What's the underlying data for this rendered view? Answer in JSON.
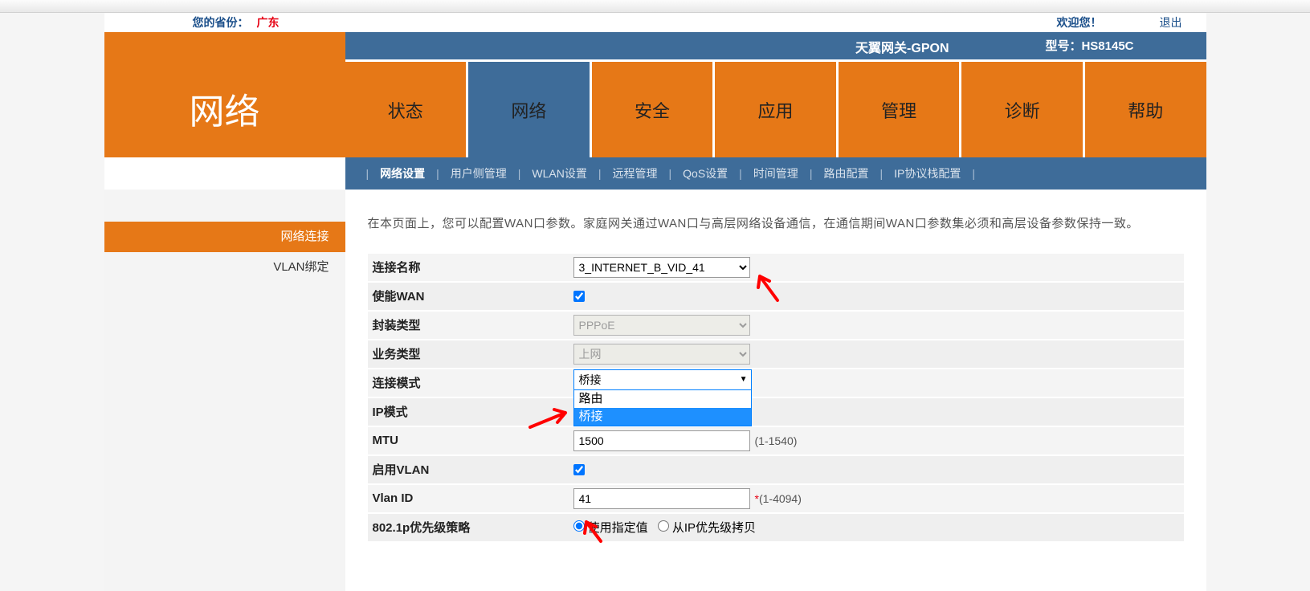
{
  "topbar": {
    "province_label": "您的省份：",
    "province_value": "广东",
    "welcome": "欢迎您！",
    "logout": "退出"
  },
  "header": {
    "gateway": "天翼网关-GPON",
    "model_label": "型号：",
    "model_value": "HS8145C",
    "section_title": "网络"
  },
  "main_tabs": [
    "状态",
    "网络",
    "安全",
    "应用",
    "管理",
    "诊断",
    "帮助"
  ],
  "main_tab_active": 1,
  "sub_tabs": [
    "网络设置",
    "用户侧管理",
    "WLAN设置",
    "远程管理",
    "QoS设置",
    "时间管理",
    "路由配置",
    "IP协议栈配置"
  ],
  "sub_tab_active": 0,
  "side_items": [
    "网络连接",
    "VLAN绑定"
  ],
  "side_active": 0,
  "description": "在本页面上，您可以配置WAN口参数。家庭网关通过WAN口与高层网络设备通信，在通信期间WAN口参数集必须和高层设备参数保持一致。",
  "form": {
    "conn_name": {
      "label": "连接名称",
      "value": "3_INTERNET_B_VID_41"
    },
    "enable_wan": {
      "label": "使能WAN",
      "checked": true
    },
    "encap": {
      "label": "封装类型",
      "value": "PPPoE"
    },
    "service": {
      "label": "业务类型",
      "value": "上网"
    },
    "conn_mode": {
      "label": "连接模式",
      "value": "桥接",
      "options": [
        "路由",
        "桥接"
      ]
    },
    "ip_mode": {
      "label": "IP模式"
    },
    "mtu": {
      "label": "MTU",
      "value": "1500",
      "hint": "(1-1540)"
    },
    "enable_vlan": {
      "label": "启用VLAN",
      "checked": true
    },
    "vlan_id": {
      "label": "Vlan ID",
      "value": "41",
      "hint": "(1-4094)"
    },
    "dot1p": {
      "label": "802.1p优先级策略",
      "opt1": "使用指定值",
      "opt2": "从IP优先级拷贝",
      "selected": 0
    }
  }
}
